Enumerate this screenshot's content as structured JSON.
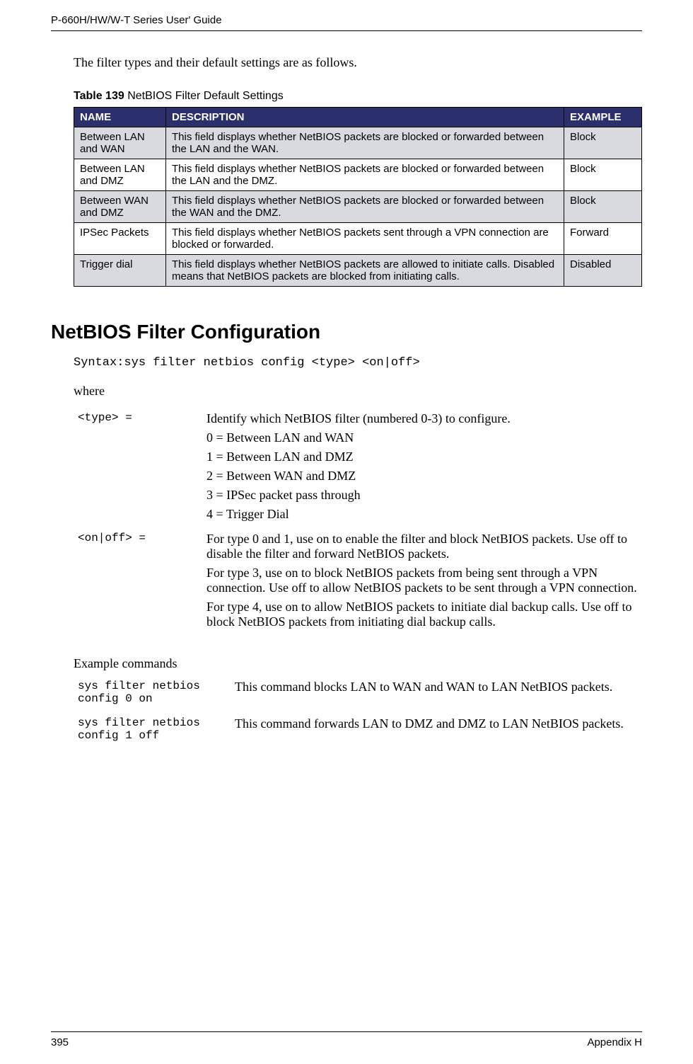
{
  "header": {
    "running_head": "P-660H/HW/W-T Series User' Guide"
  },
  "intro": "The filter types and their default settings are as follows.",
  "table_caption_prefix": "Table 139",
  "table_caption_text": "   NetBIOS Filter Default Settings",
  "table_headers": {
    "name": "NAME",
    "description": "DESCRIPTION",
    "example": "EXAMPLE"
  },
  "table_rows": [
    {
      "name": "Between LAN and WAN",
      "desc": "This field displays whether NetBIOS packets are blocked or forwarded between the LAN and the WAN.",
      "ex": "Block"
    },
    {
      "name": "Between LAN and DMZ",
      "desc": "This field displays whether NetBIOS packets are blocked or forwarded between the LAN and the DMZ.",
      "ex": "Block"
    },
    {
      "name": "Between WAN and DMZ",
      "desc": "This field displays whether NetBIOS packets are blocked or forwarded between the WAN and the DMZ.",
      "ex": "Block"
    },
    {
      "name": "IPSec Packets",
      "desc": "This field displays whether NetBIOS packets sent through a VPN connection are blocked or forwarded.",
      "ex": "Forward"
    },
    {
      "name": "Trigger dial",
      "desc": "This field displays whether NetBIOS packets are allowed to initiate calls. Disabled means that NetBIOS packets are blocked from initiating calls.",
      "ex": "Disabled"
    }
  ],
  "section_title": "NetBIOS Filter Configuration",
  "syntax_line": "Syntax:sys filter netbios config <type> <on|off>",
  "where_label": "where",
  "params": {
    "type_label": "<type> =",
    "type_desc_intro": "Identify which NetBIOS filter (numbered 0-3) to configure.",
    "type_desc_0": "0 = Between LAN and WAN",
    "type_desc_1": "1 = Between LAN and DMZ",
    "type_desc_2": "2 = Between WAN and DMZ",
    "type_desc_3": "3 = IPSec packet pass through",
    "type_desc_4": "4 = Trigger Dial",
    "onoff_label": "<on|off> =",
    "onoff_desc_1": "For type 0 and 1, use on to enable the filter and block NetBIOS packets. Use off to disable the filter and forward NetBIOS packets.",
    "onoff_desc_2": "For type 3, use on to block NetBIOS packets from being sent through a VPN connection. Use off to allow NetBIOS packets to be sent through a VPN connection.",
    "onoff_desc_3": "For type 4, use on to allow NetBIOS packets to initiate dial backup calls. Use off to block NetBIOS packets from initiating dial backup calls."
  },
  "examples_label": "Example commands",
  "examples": [
    {
      "cmd": "sys filter netbios config 0 on",
      "desc": "This command blocks LAN to WAN and WAN to LAN NetBIOS packets."
    },
    {
      "cmd": "sys filter netbios config 1 off",
      "desc": "This command forwards LAN to DMZ and DMZ to LAN NetBIOS packets."
    }
  ],
  "footer": {
    "page": "395",
    "appendix": "Appendix H"
  }
}
